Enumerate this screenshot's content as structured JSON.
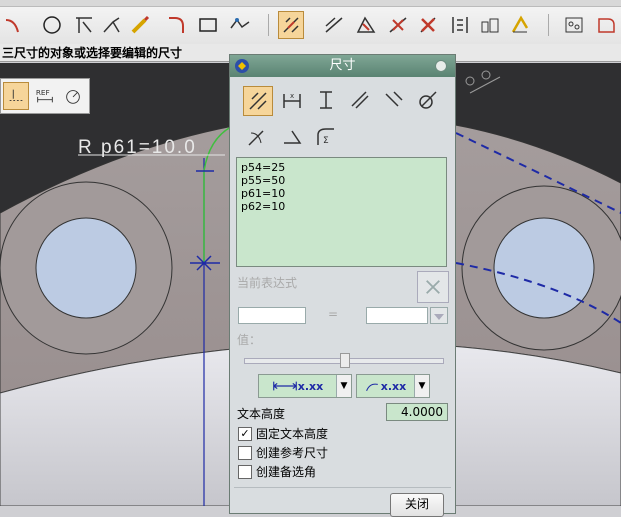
{
  "cue_line": "三尺寸的对象或选择要编辑的尺寸",
  "viewport": {
    "dim_label": "R p61=10.0"
  },
  "dialog": {
    "title": "尺寸",
    "expressions": [
      "p54=25",
      "p55=50",
      "p61=10",
      "p62=10"
    ],
    "current_expr_label": "当前表达式",
    "equals": "=",
    "value_label": "值：",
    "text_height_label": "文本高度",
    "text_height_value": "4.0000",
    "combo_left_text": "x.xx",
    "combo_right_text": "x.xx",
    "checks": [
      {
        "label": "固定文本高度",
        "checked": true
      },
      {
        "label": "创建参考尺寸",
        "checked": false
      },
      {
        "label": "创建备选角",
        "checked": false
      }
    ],
    "close_label": "关闭",
    "slider_value": 0.5
  },
  "toolbar_icons": [
    "arc-icon",
    "circle-icon",
    "trim-icon",
    "extend-icon",
    "pencil-icon",
    "fillet-icon",
    "rectangle-icon",
    "profile-icon",
    "dimension-icon",
    "constraint-icon",
    "show-constraints-icon",
    "convert-ref-icon",
    "mirror-icon",
    "grid-icon",
    "offset-icon",
    "table-icon",
    "shape-icon"
  ]
}
